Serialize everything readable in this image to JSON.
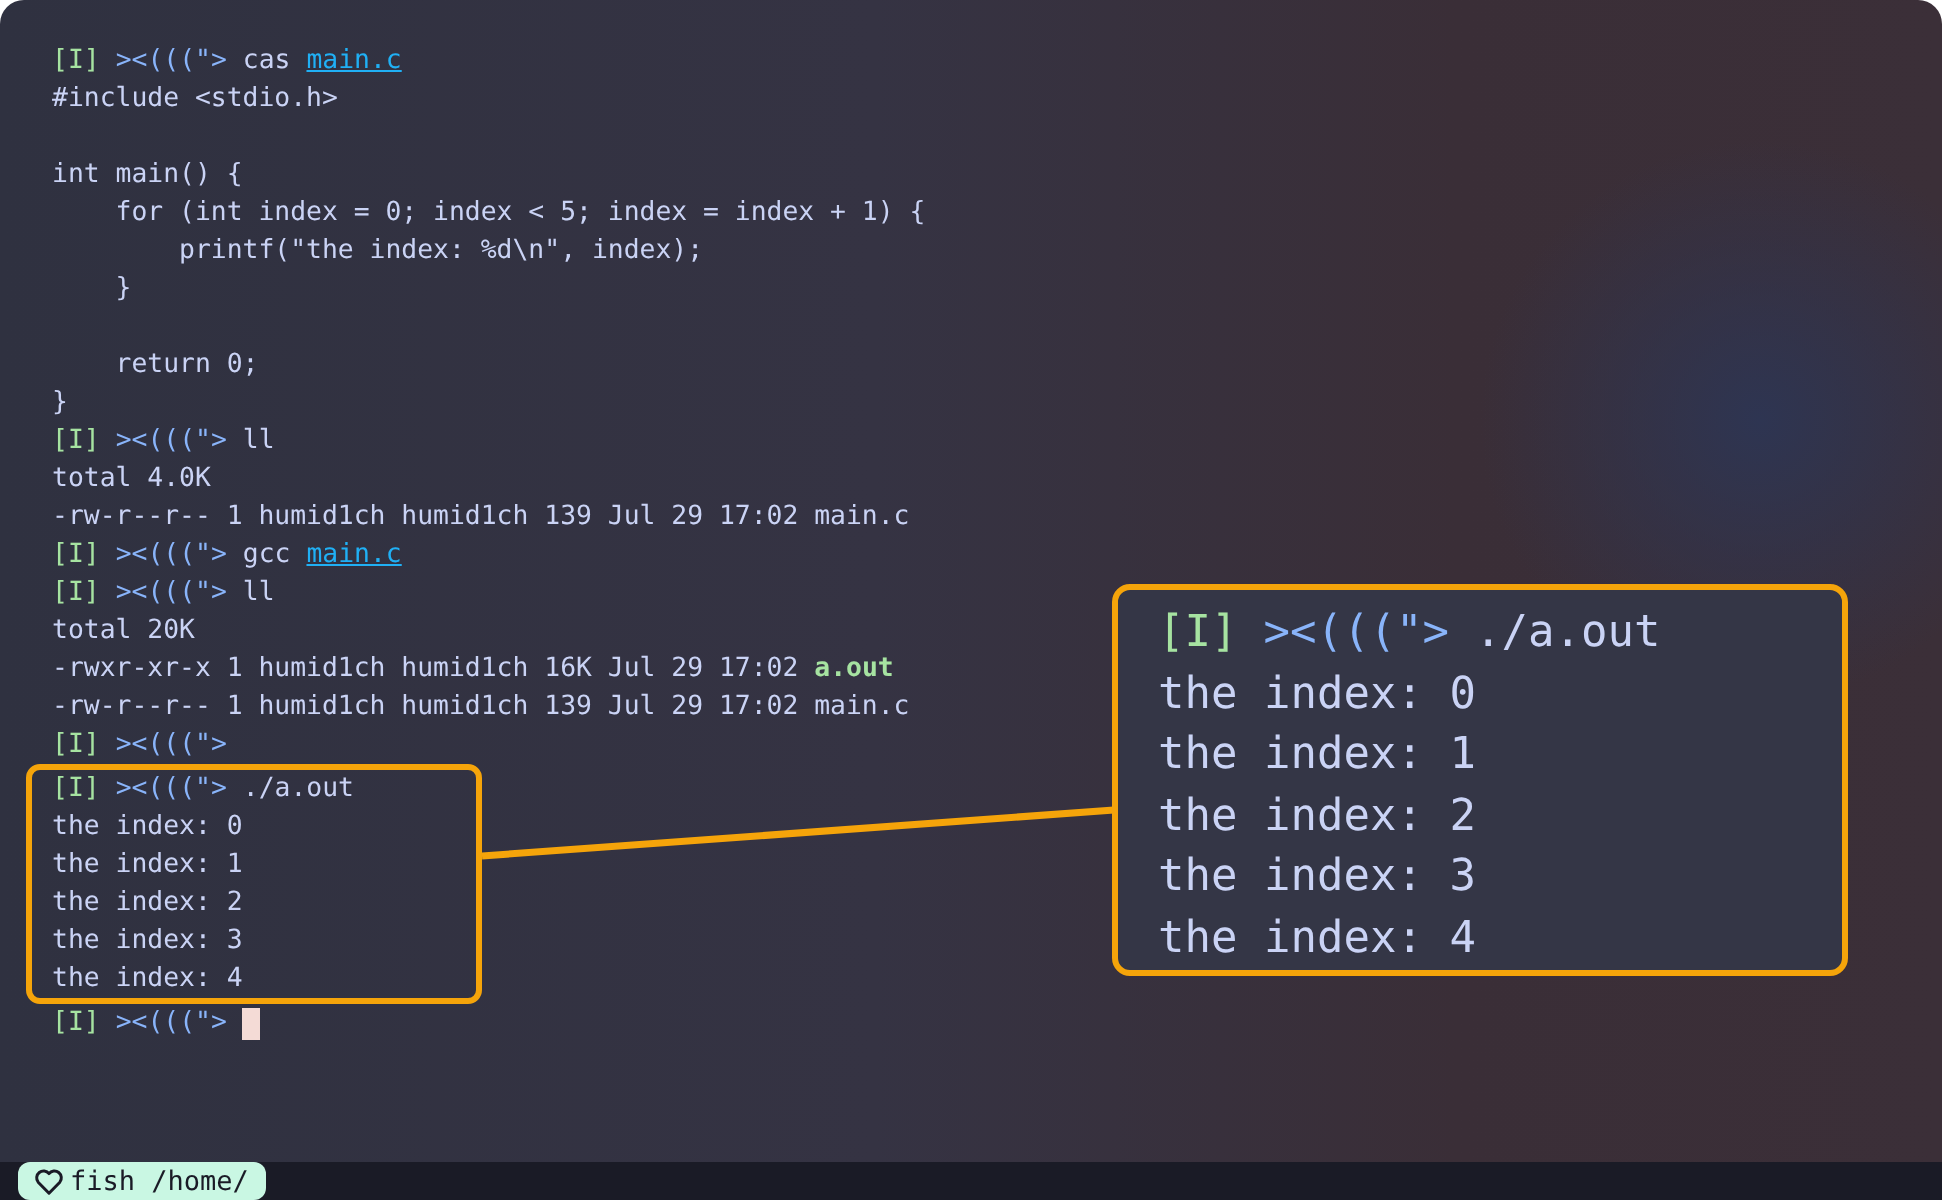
{
  "terminal": {
    "lines_before": [
      {
        "segments": [
          {
            "kind": "mode",
            "text": "[I]"
          },
          {
            "kind": "fish",
            "text": "><(((\">"
          },
          {
            "kind": "text",
            "text": "cas"
          },
          {
            "kind": "link",
            "text": "main.c"
          }
        ]
      },
      {
        "segments": [
          {
            "kind": "text",
            "text": "#include <stdio.h>\n\nint main() {\n    for (int index = 0; index < 5; index = index + 1) {\n        printf(\"the index: %d\\n\", index);\n    }\n\n    return 0;\n}"
          }
        ]
      },
      {
        "segments": [
          {
            "kind": "mode",
            "text": "[I]"
          },
          {
            "kind": "fish",
            "text": "><(((\">"
          },
          {
            "kind": "text",
            "text": "ll"
          }
        ]
      },
      {
        "segments": [
          {
            "kind": "text",
            "text": "total 4.0K"
          }
        ]
      },
      {
        "segments": [
          {
            "kind": "text",
            "text": "-rw-r--r-- 1 humid1ch humid1ch 139 Jul 29 17:02 main.c"
          }
        ]
      },
      {
        "segments": [
          {
            "kind": "mode",
            "text": "[I]"
          },
          {
            "kind": "fish",
            "text": "><(((\">"
          },
          {
            "kind": "text",
            "text": "gcc"
          },
          {
            "kind": "link",
            "text": "main.c"
          }
        ]
      },
      {
        "segments": [
          {
            "kind": "mode",
            "text": "[I]"
          },
          {
            "kind": "fish",
            "text": "><(((\">"
          },
          {
            "kind": "text",
            "text": "ll"
          }
        ]
      },
      {
        "segments": [
          {
            "kind": "text",
            "text": "total 20K"
          }
        ]
      },
      {
        "segments": [
          {
            "kind": "text",
            "text": "-rwxr-xr-x 1 humid1ch humid1ch 16K Jul 29 17:02"
          },
          {
            "kind": "exec",
            "text": "a.out"
          }
        ]
      },
      {
        "segments": [
          {
            "kind": "text",
            "text": "-rw-r--r-- 1 humid1ch humid1ch 139 Jul 29 17:02 main.c"
          }
        ]
      },
      {
        "segments": [
          {
            "kind": "mode",
            "text": "[I]"
          },
          {
            "kind": "fish",
            "text": "><(((\">"
          }
        ]
      }
    ],
    "highlighted": [
      {
        "segments": [
          {
            "kind": "mode",
            "text": "[I]"
          },
          {
            "kind": "fish",
            "text": "><(((\">"
          },
          {
            "kind": "text",
            "text": "./a.out"
          }
        ]
      },
      {
        "segments": [
          {
            "kind": "text",
            "text": "the index: 0"
          }
        ]
      },
      {
        "segments": [
          {
            "kind": "text",
            "text": "the index: 1"
          }
        ]
      },
      {
        "segments": [
          {
            "kind": "text",
            "text": "the index: 2"
          }
        ]
      },
      {
        "segments": [
          {
            "kind": "text",
            "text": "the index: 3"
          }
        ]
      },
      {
        "segments": [
          {
            "kind": "text",
            "text": "the index: 4"
          }
        ]
      }
    ],
    "lines_after": [
      {
        "segments": [
          {
            "kind": "mode",
            "text": "[I]"
          },
          {
            "kind": "fish",
            "text": "><(((\">"
          },
          {
            "kind": "cursor"
          }
        ]
      }
    ]
  },
  "callout": {
    "lines": [
      {
        "segments": [
          {
            "kind": "mode",
            "text": "[I]"
          },
          {
            "kind": "fish",
            "text": "><(((\">"
          },
          {
            "kind": "text",
            "text": "./a.out"
          }
        ]
      },
      {
        "segments": [
          {
            "kind": "text",
            "text": "the index: 0"
          }
        ]
      },
      {
        "segments": [
          {
            "kind": "text",
            "text": "the index: 1"
          }
        ]
      },
      {
        "segments": [
          {
            "kind": "text",
            "text": "the index: 2"
          }
        ]
      },
      {
        "segments": [
          {
            "kind": "text",
            "text": "the index: 3"
          }
        ]
      },
      {
        "segments": [
          {
            "kind": "text",
            "text": "the index: 4"
          }
        ]
      }
    ]
  },
  "status_bar": {
    "label": "fish /home/"
  }
}
